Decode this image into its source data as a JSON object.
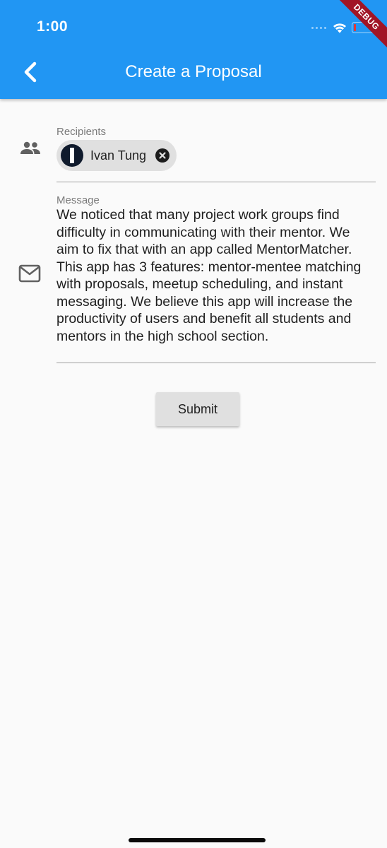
{
  "status_bar": {
    "time": "1:00",
    "debug_label": "DEBUG"
  },
  "app_bar": {
    "title": "Create a Proposal",
    "back_icon": "chevron-left-icon",
    "background_color": "#2196f3"
  },
  "recipients": {
    "label": "Recipients",
    "icon": "people-icon",
    "chips": [
      {
        "name": "Ivan Tung",
        "delete_icon": "cancel-circle-icon"
      }
    ]
  },
  "message": {
    "label": "Message",
    "icon": "mail-outline-icon",
    "value": "We noticed that many project work groups find\ndifficulty in communicating with their mentor. We\naim to fix that with an app called MentorMatcher.\nThis app has 3 features: mentor-mentee matching\nwith proposals, meetup scheduling, and instant\nmessaging. We believe this app will increase the\nproductivity of users and benefit all students and\nmentors in the high school section."
  },
  "submit": {
    "label": "Submit"
  }
}
